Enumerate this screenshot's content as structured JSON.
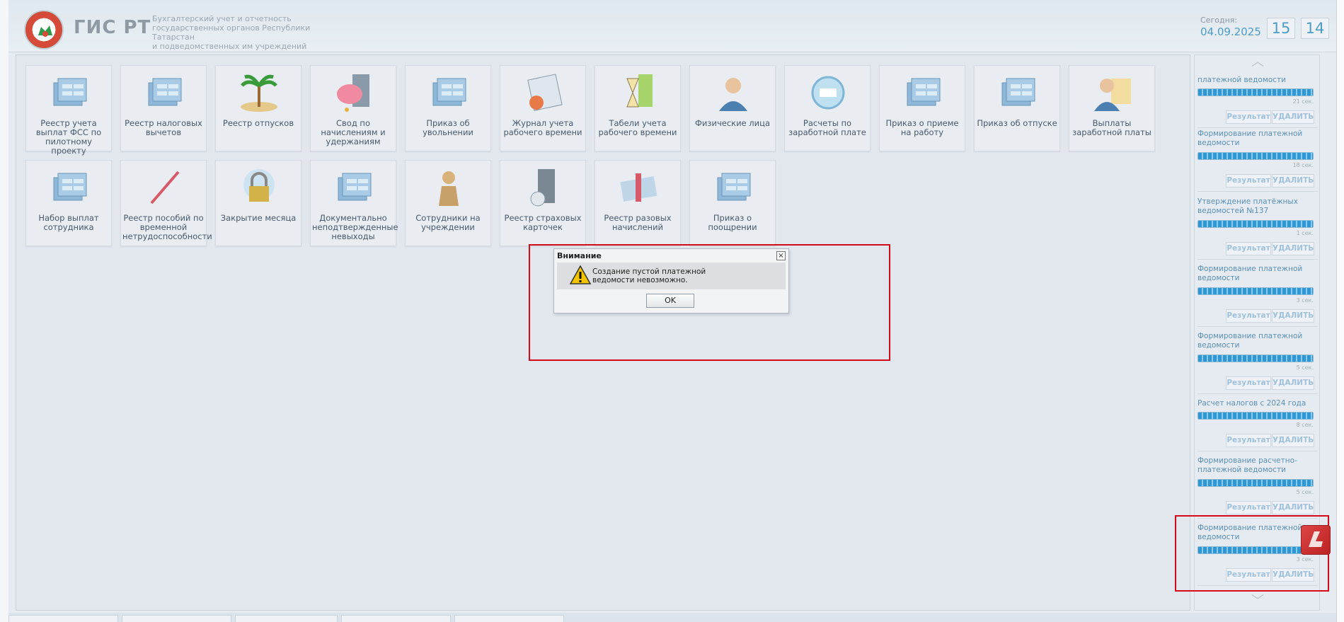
{
  "header": {
    "app_name": "ГИС РТ",
    "description_lines": [
      "Бухгалтерский учет и отчетность",
      "государственных органов Республики Татарстан",
      "и подведомственных им учреждений"
    ],
    "today_label": "Сегодня:",
    "today_date": "04.09.2025",
    "time_hours": "15",
    "time_minutes": "14"
  },
  "tiles": [
    {
      "label": "Реестр учета выплат ФСС по пилотному проекту",
      "icon": "cabinet-icon"
    },
    {
      "label": "Реестр налоговых вычетов",
      "icon": "cabinet-icon"
    },
    {
      "label": "Реестр отпусков",
      "icon": "palm-beach-icon"
    },
    {
      "label": "Свод по начислениям и удержаниям",
      "icon": "piggy-bank-book-icon"
    },
    {
      "label": "Приказ об увольнении",
      "icon": "cabinet-icon"
    },
    {
      "label": "Журнал учета рабочего времени",
      "icon": "calendar-clock-icon"
    },
    {
      "label": "Табели учета рабочего времени",
      "icon": "hourglass-book-icon"
    },
    {
      "label": "Физические лица",
      "icon": "person-icon"
    },
    {
      "label": "Расчеты по заработной плате",
      "icon": "money-stamp-icon"
    },
    {
      "label": "Приказ о приеме на работу",
      "icon": "cabinet-icon"
    },
    {
      "label": "Приказ об отпуске",
      "icon": "cabinet-icon"
    },
    {
      "label": "Выплаты заработной платы",
      "icon": "person-money-icon"
    },
    {
      "label": "Набор выплат сотрудника",
      "icon": "cabinet-icon"
    },
    {
      "label": "Реестр пособий по временной нетрудоспособности",
      "icon": "thermometer-icon"
    },
    {
      "label": "Закрытие месяца",
      "icon": "padlock-icon"
    },
    {
      "label": "Документально неподтвержденные невыходы",
      "icon": "cabinet-icon"
    },
    {
      "label": "Сотрудники на учреждении",
      "icon": "worker-figure-icon"
    },
    {
      "label": "Реестр страховых карточек",
      "icon": "book-disk-icon"
    },
    {
      "label": "Реестр разовых начислений",
      "icon": "gift-money-icon"
    },
    {
      "label": "Приказ о поощрении",
      "icon": "cabinet-icon"
    }
  ],
  "tasks": [
    {
      "title": "платежной ведомости",
      "time": "21 сек.",
      "progress": 1.0
    },
    {
      "title": "Формирование платежной ведомости",
      "time": "18 сек.",
      "progress": 1.0
    },
    {
      "title": "Утверждение платёжных ведомостей №137",
      "time": "1 сек.",
      "progress": 1.0
    },
    {
      "title": "Формирование платежной ведомости",
      "time": "3 сек.",
      "progress": 1.0
    },
    {
      "title": "Формирование платежной ведомости",
      "time": "5 сек.",
      "progress": 1.0
    },
    {
      "title": "Расчет налогов с 2024 года",
      "time": "8 сек.",
      "progress": 1.0
    },
    {
      "title": "Формирование расчетно-платежной ведомости",
      "time": "5 сек.",
      "progress": 1.0
    },
    {
      "title": "Формирование платежной ведомости",
      "time": "3 сек.",
      "progress": 1.0
    }
  ],
  "task_buttons": {
    "result": "Результат",
    "delete": "УДАЛИТЬ"
  },
  "dialog": {
    "title": "Внимание",
    "message": "Создание пустой платежной ведомости невозможно.",
    "ok": "OK",
    "close": "×"
  },
  "colors": {
    "highlight": "#d20a1a",
    "accent": "#4d9cc6",
    "progress": "#2f97d3"
  }
}
